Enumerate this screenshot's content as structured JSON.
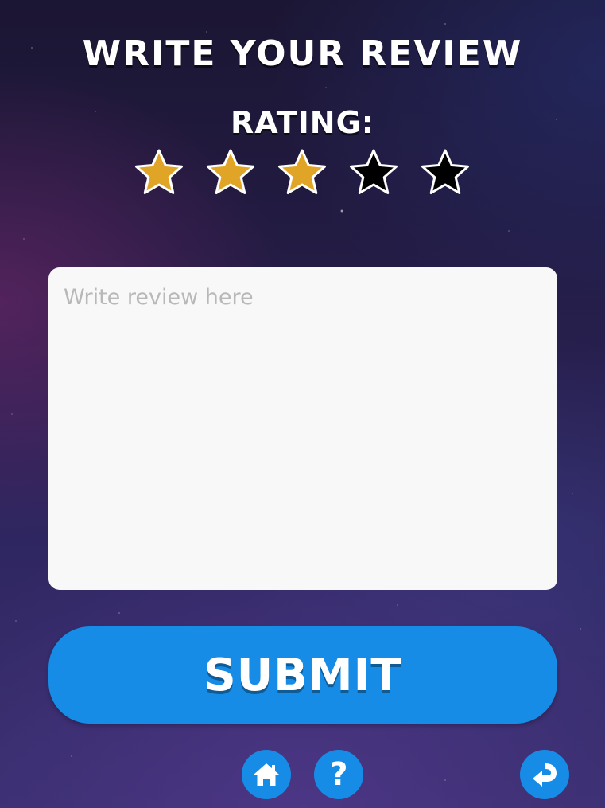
{
  "header": {
    "title": "WRITE YOUR REVIEW",
    "rating_label": "RATING:"
  },
  "rating": {
    "value": 3,
    "max": 5,
    "filled_color": "#e0a526",
    "empty_color": "#000000",
    "outline_color": "#ffffff"
  },
  "review": {
    "placeholder": "Write review here",
    "value": ""
  },
  "submit": {
    "label": "SUBMIT",
    "color": "#168ce6"
  },
  "footer": {
    "home_icon": "home-icon",
    "help_icon": "help-icon",
    "help_glyph": "?",
    "back_icon": "back-arrow-icon"
  }
}
